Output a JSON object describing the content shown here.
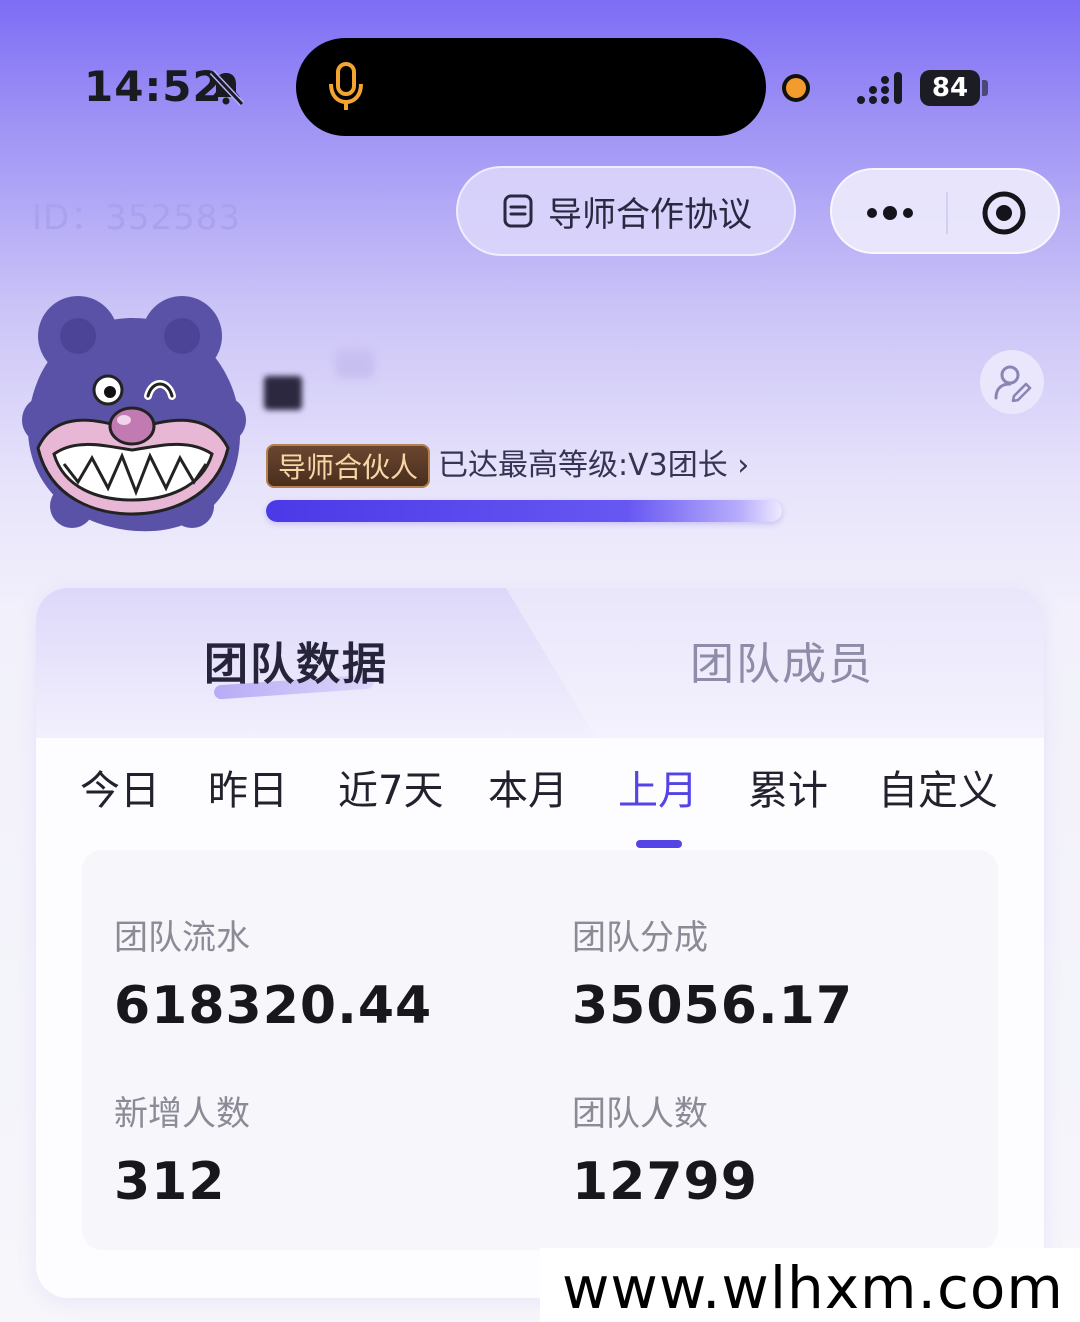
{
  "status_bar": {
    "time": "14:52",
    "battery": "84"
  },
  "header": {
    "user_id": "ID：352583",
    "agreement_button": "导师合作协议",
    "icons": [
      "more-icon",
      "target-icon",
      "doc-icon",
      "edit-user-icon"
    ]
  },
  "profile": {
    "role_badge": "导师合伙人",
    "level_text": "已达最高等级:V3团长 ›",
    "level_progress": 1.0
  },
  "tabs": {
    "active": "团队数据",
    "inactive": "团队成员"
  },
  "periods": [
    {
      "label": "今日",
      "active": false
    },
    {
      "label": "昨日",
      "active": false
    },
    {
      "label": "近7天",
      "active": false
    },
    {
      "label": "本月",
      "active": false
    },
    {
      "label": "上月",
      "active": true
    },
    {
      "label": "累计",
      "active": false
    },
    {
      "label": "自定义",
      "active": false
    }
  ],
  "stats": [
    {
      "label": "团队流水",
      "value": "618320.44"
    },
    {
      "label": "团队分成",
      "value": "35056.17"
    },
    {
      "label": "新增人数",
      "value": "312"
    },
    {
      "label": "团队人数",
      "value": "12799"
    }
  ],
  "colors": {
    "accent": "#5444e6",
    "badge_bg": "#5a3a26",
    "badge_text": "#f7d7a8"
  },
  "watermark": "www.wlhxm.com"
}
